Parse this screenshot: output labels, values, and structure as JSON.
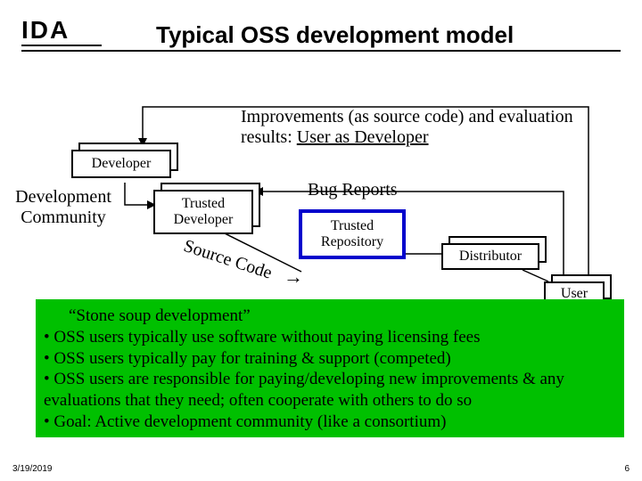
{
  "header": {
    "logo": "IDA",
    "title": "Typical OSS development model"
  },
  "diagram": {
    "improvements_text": "Improvements (as source code) and evaluation results: ",
    "improvements_emphasis": "User as Developer",
    "developer_label": "Developer",
    "dev_community_line1": "Development",
    "dev_community_line2": "Community",
    "trusted_developer_line1": "Trusted",
    "trusted_developer_line2": "Developer",
    "bug_reports": "Bug Reports",
    "trusted_repo_line1": "Trusted",
    "trusted_repo_line2": "Repository",
    "source_code": "Source Code",
    "distributor": "Distributor",
    "user": "User",
    "arrow_glyph": "→"
  },
  "bullets": {
    "lead": "“Stone soup development”",
    "b1": "• OSS users typically use software without paying licensing fees",
    "b2": "• OSS users typically pay for training & support (competed)",
    "b3": "• OSS users are responsible for paying/developing new improvements & any evaluations that they need; often cooperate with others to do so",
    "b4": "• Goal: Active development community (like a consortium)"
  },
  "footer": {
    "date": "3/19/2019",
    "page": "6"
  }
}
